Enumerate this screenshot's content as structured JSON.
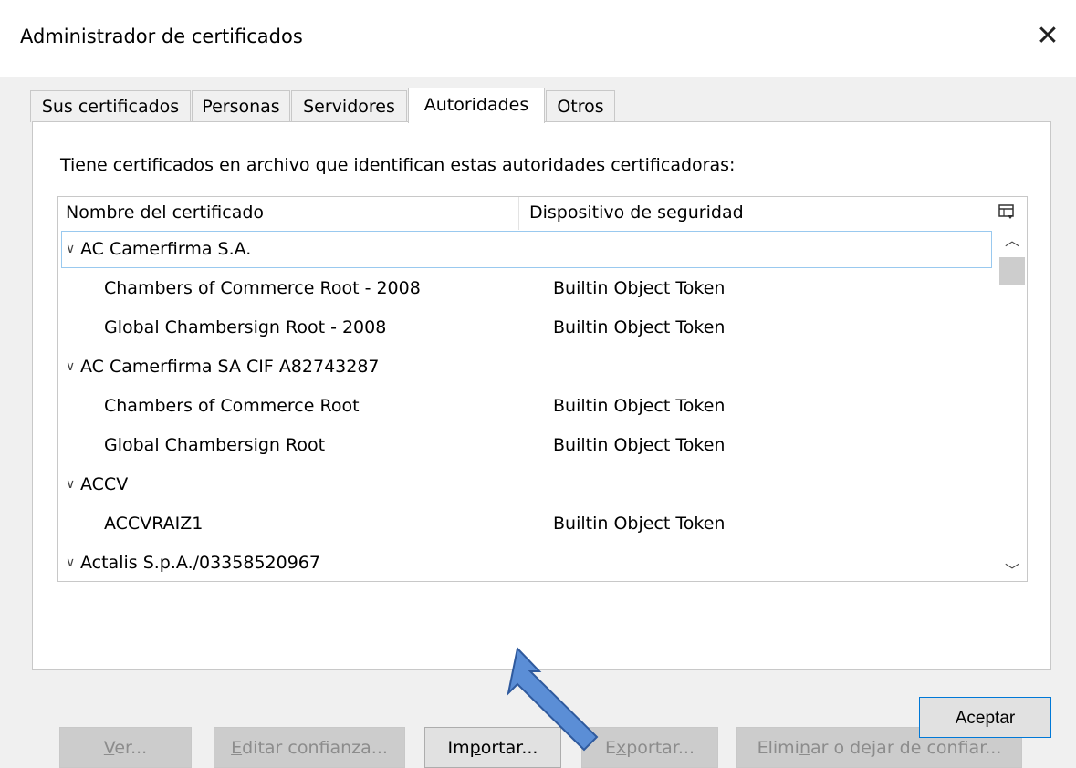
{
  "window": {
    "title": "Administrador de certificados"
  },
  "tabs": [
    {
      "label": "Sus certificados"
    },
    {
      "label": "Personas"
    },
    {
      "label": "Servidores"
    },
    {
      "label": "Autoridades",
      "selected": true
    },
    {
      "label": "Otros"
    }
  ],
  "panel": {
    "description": "Tiene certificados en archivo que identifican estas autoridades certificadoras:",
    "columns": {
      "name": "Nombre del certificado",
      "device": "Dispositivo de seguridad"
    }
  },
  "tree": [
    {
      "kind": "group",
      "name": "AC Camerfirma S.A."
    },
    {
      "kind": "cert",
      "name": "Chambers of Commerce Root - 2008",
      "device": "Builtin Object Token"
    },
    {
      "kind": "cert",
      "name": "Global Chambersign Root - 2008",
      "device": "Builtin Object Token"
    },
    {
      "kind": "group",
      "name": "AC Camerfirma SA CIF A82743287"
    },
    {
      "kind": "cert",
      "name": "Chambers of Commerce Root",
      "device": "Builtin Object Token"
    },
    {
      "kind": "cert",
      "name": "Global Chambersign Root",
      "device": "Builtin Object Token"
    },
    {
      "kind": "group",
      "name": "ACCV"
    },
    {
      "kind": "cert",
      "name": "ACCVRAIZ1",
      "device": "Builtin Object Token"
    },
    {
      "kind": "group",
      "name": "Actalis S.p.A./03358520967"
    }
  ],
  "buttons": {
    "view": {
      "pre": "",
      "u": "V",
      "post": "er...",
      "enabled": false
    },
    "edit": {
      "pre": "",
      "u": "E",
      "post": "ditar confianza...",
      "enabled": false
    },
    "import": {
      "pre": "Im",
      "u": "p",
      "post": "ortar...",
      "enabled": true
    },
    "export": {
      "pre": "E",
      "u": "x",
      "post": "portar...",
      "enabled": false
    },
    "delete": {
      "pre": "Elimi",
      "u": "n",
      "post": "ar o dejar de confiar...",
      "enabled": false
    }
  },
  "footer": {
    "ok_label": "Aceptar"
  },
  "colors": {
    "arrow_fill": "#5b8ed6",
    "arrow_stroke": "#2f5a9e",
    "focus_ring": "#0078d7"
  },
  "icons": [
    "close-icon",
    "chevron-down-icon",
    "column-picker-icon",
    "scroll-up-icon",
    "scroll-down-icon"
  ]
}
